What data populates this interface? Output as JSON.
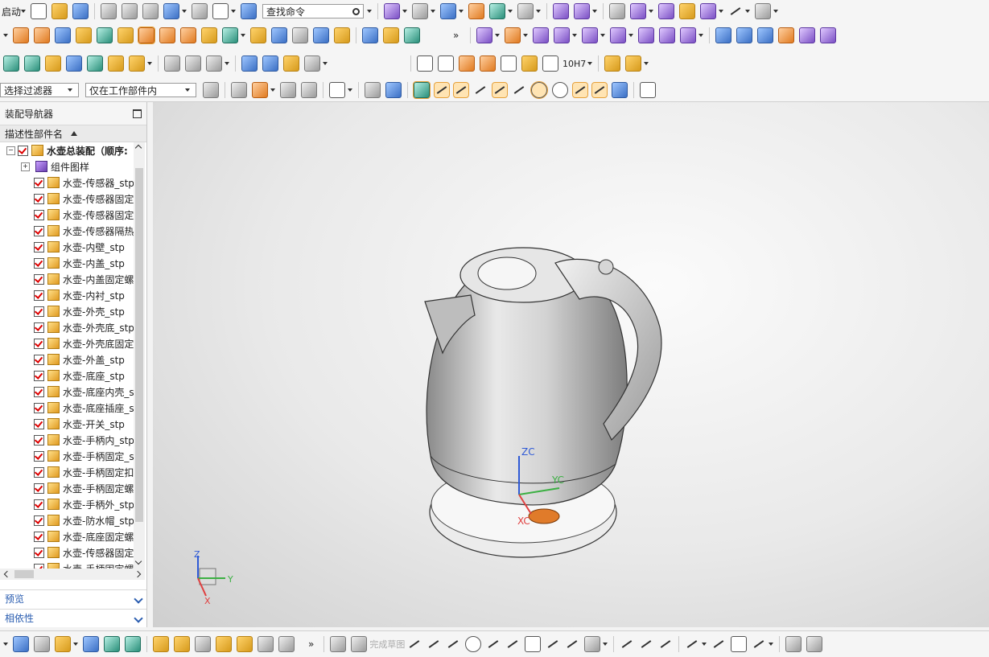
{
  "toolbar": {
    "start_label": "启动",
    "search_placeholder": "查找命令",
    "filter_select": "选择过滤器",
    "scope_select": "仅在工作部件内",
    "tolerance_label": "10H7",
    "sketch_label": "完成草图"
  },
  "navigator": {
    "title": "装配导航器",
    "column_header": "描述性部件名",
    "root": "水壶总装配（顺序:",
    "group": "组件图样",
    "items": [
      "水壶-传感器_stp",
      "水壶-传感器固定",
      "水壶-传感器固定",
      "水壶-传感器隔热",
      "水壶-内壁_stp",
      "水壶-内盖_stp",
      "水壶-内盖固定螺",
      "水壶-内衬_stp",
      "水壶-外壳_stp",
      "水壶-外壳底_stp",
      "水壶-外壳底固定",
      "水壶-外盖_stp",
      "水壶-底座_stp",
      "水壶-底座内壳_s",
      "水壶-底座插座_s",
      "水壶-开关_stp",
      "水壶-手柄内_stp",
      "水壶-手柄固定_s",
      "水壶-手柄固定扣",
      "水壶-手柄固定螺",
      "水壶-手柄外_stp",
      "水壶-防水帽_stp",
      "水壶-底座固定螺",
      "水壶-传感器固定",
      "水壶-手柄固定螺"
    ],
    "preview_label": "预览",
    "dependency_label": "相依性"
  },
  "viewport": {
    "wcs_z": "ZC",
    "wcs_y": "YC",
    "wcs_x": "XC",
    "triad_z": "Z",
    "triad_y": "Y",
    "triad_x": "X"
  }
}
